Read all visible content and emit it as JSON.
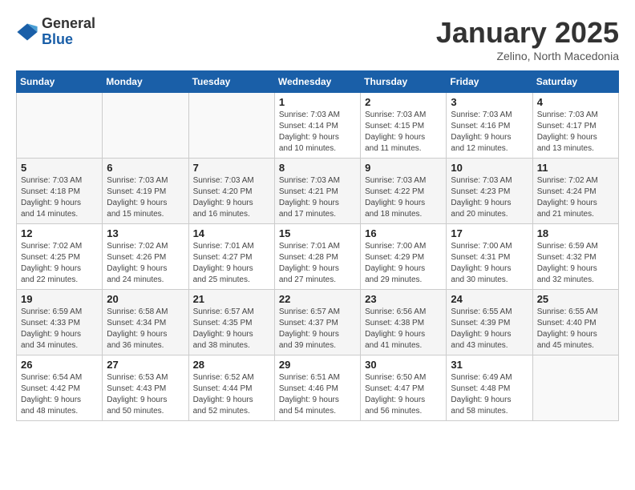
{
  "header": {
    "logo_general": "General",
    "logo_blue": "Blue",
    "month_title": "January 2025",
    "subtitle": "Zelino, North Macedonia"
  },
  "weekdays": [
    "Sunday",
    "Monday",
    "Tuesday",
    "Wednesday",
    "Thursday",
    "Friday",
    "Saturday"
  ],
  "weeks": [
    [
      {
        "day": "",
        "info": ""
      },
      {
        "day": "",
        "info": ""
      },
      {
        "day": "",
        "info": ""
      },
      {
        "day": "1",
        "info": "Sunrise: 7:03 AM\nSunset: 4:14 PM\nDaylight: 9 hours\nand 10 minutes."
      },
      {
        "day": "2",
        "info": "Sunrise: 7:03 AM\nSunset: 4:15 PM\nDaylight: 9 hours\nand 11 minutes."
      },
      {
        "day": "3",
        "info": "Sunrise: 7:03 AM\nSunset: 4:16 PM\nDaylight: 9 hours\nand 12 minutes."
      },
      {
        "day": "4",
        "info": "Sunrise: 7:03 AM\nSunset: 4:17 PM\nDaylight: 9 hours\nand 13 minutes."
      }
    ],
    [
      {
        "day": "5",
        "info": "Sunrise: 7:03 AM\nSunset: 4:18 PM\nDaylight: 9 hours\nand 14 minutes."
      },
      {
        "day": "6",
        "info": "Sunrise: 7:03 AM\nSunset: 4:19 PM\nDaylight: 9 hours\nand 15 minutes."
      },
      {
        "day": "7",
        "info": "Sunrise: 7:03 AM\nSunset: 4:20 PM\nDaylight: 9 hours\nand 16 minutes."
      },
      {
        "day": "8",
        "info": "Sunrise: 7:03 AM\nSunset: 4:21 PM\nDaylight: 9 hours\nand 17 minutes."
      },
      {
        "day": "9",
        "info": "Sunrise: 7:03 AM\nSunset: 4:22 PM\nDaylight: 9 hours\nand 18 minutes."
      },
      {
        "day": "10",
        "info": "Sunrise: 7:03 AM\nSunset: 4:23 PM\nDaylight: 9 hours\nand 20 minutes."
      },
      {
        "day": "11",
        "info": "Sunrise: 7:02 AM\nSunset: 4:24 PM\nDaylight: 9 hours\nand 21 minutes."
      }
    ],
    [
      {
        "day": "12",
        "info": "Sunrise: 7:02 AM\nSunset: 4:25 PM\nDaylight: 9 hours\nand 22 minutes."
      },
      {
        "day": "13",
        "info": "Sunrise: 7:02 AM\nSunset: 4:26 PM\nDaylight: 9 hours\nand 24 minutes."
      },
      {
        "day": "14",
        "info": "Sunrise: 7:01 AM\nSunset: 4:27 PM\nDaylight: 9 hours\nand 25 minutes."
      },
      {
        "day": "15",
        "info": "Sunrise: 7:01 AM\nSunset: 4:28 PM\nDaylight: 9 hours\nand 27 minutes."
      },
      {
        "day": "16",
        "info": "Sunrise: 7:00 AM\nSunset: 4:29 PM\nDaylight: 9 hours\nand 29 minutes."
      },
      {
        "day": "17",
        "info": "Sunrise: 7:00 AM\nSunset: 4:31 PM\nDaylight: 9 hours\nand 30 minutes."
      },
      {
        "day": "18",
        "info": "Sunrise: 6:59 AM\nSunset: 4:32 PM\nDaylight: 9 hours\nand 32 minutes."
      }
    ],
    [
      {
        "day": "19",
        "info": "Sunrise: 6:59 AM\nSunset: 4:33 PM\nDaylight: 9 hours\nand 34 minutes."
      },
      {
        "day": "20",
        "info": "Sunrise: 6:58 AM\nSunset: 4:34 PM\nDaylight: 9 hours\nand 36 minutes."
      },
      {
        "day": "21",
        "info": "Sunrise: 6:57 AM\nSunset: 4:35 PM\nDaylight: 9 hours\nand 38 minutes."
      },
      {
        "day": "22",
        "info": "Sunrise: 6:57 AM\nSunset: 4:37 PM\nDaylight: 9 hours\nand 39 minutes."
      },
      {
        "day": "23",
        "info": "Sunrise: 6:56 AM\nSunset: 4:38 PM\nDaylight: 9 hours\nand 41 minutes."
      },
      {
        "day": "24",
        "info": "Sunrise: 6:55 AM\nSunset: 4:39 PM\nDaylight: 9 hours\nand 43 minutes."
      },
      {
        "day": "25",
        "info": "Sunrise: 6:55 AM\nSunset: 4:40 PM\nDaylight: 9 hours\nand 45 minutes."
      }
    ],
    [
      {
        "day": "26",
        "info": "Sunrise: 6:54 AM\nSunset: 4:42 PM\nDaylight: 9 hours\nand 48 minutes."
      },
      {
        "day": "27",
        "info": "Sunrise: 6:53 AM\nSunset: 4:43 PM\nDaylight: 9 hours\nand 50 minutes."
      },
      {
        "day": "28",
        "info": "Sunrise: 6:52 AM\nSunset: 4:44 PM\nDaylight: 9 hours\nand 52 minutes."
      },
      {
        "day": "29",
        "info": "Sunrise: 6:51 AM\nSunset: 4:46 PM\nDaylight: 9 hours\nand 54 minutes."
      },
      {
        "day": "30",
        "info": "Sunrise: 6:50 AM\nSunset: 4:47 PM\nDaylight: 9 hours\nand 56 minutes."
      },
      {
        "day": "31",
        "info": "Sunrise: 6:49 AM\nSunset: 4:48 PM\nDaylight: 9 hours\nand 58 minutes."
      },
      {
        "day": "",
        "info": ""
      }
    ]
  ]
}
